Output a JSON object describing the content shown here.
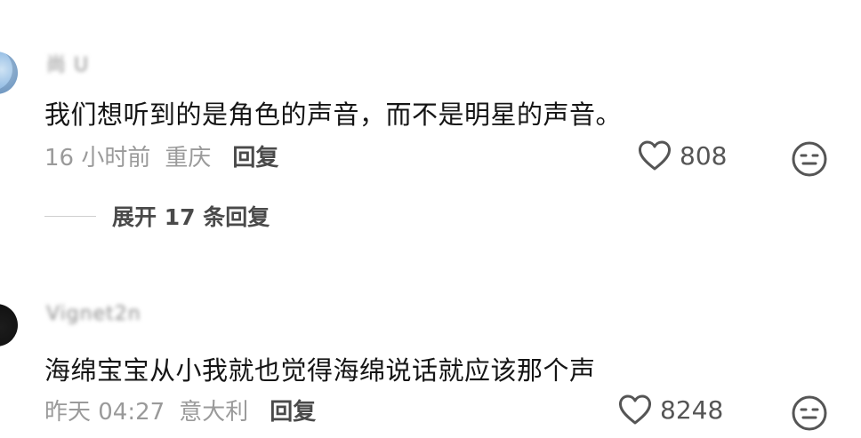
{
  "comments": [
    {
      "username": "尚 U",
      "text": "我们想听到的是角色的声音，而不是明星的声音。",
      "time": "16 小时前",
      "location": "重庆",
      "reply_label": "回复",
      "likes": "808",
      "replies_toggle": "展开 17 条回复"
    },
    {
      "username": "Vignet2n",
      "text": "海绵宝宝从小我就也觉得海绵说话就应该那个声",
      "time": "昨天 04:27",
      "location": "意大利",
      "reply_label": "回复",
      "likes": "8248"
    }
  ],
  "colors": {
    "text_primary": "#151515",
    "text_meta": "#9a9a9a",
    "text_action": "#4a4a4a",
    "icon": "#555555"
  },
  "icons": {
    "like": "heart-outline-icon",
    "dislike": "meh-face-icon"
  }
}
